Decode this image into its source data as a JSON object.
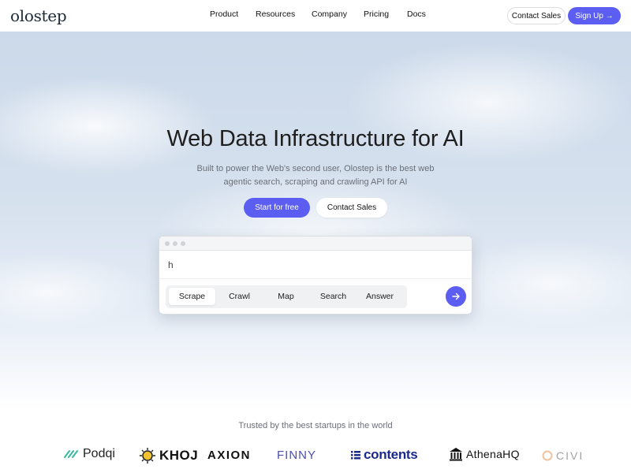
{
  "header": {
    "logo": "olostep",
    "nav": [
      "Product",
      "Resources",
      "Company",
      "Pricing",
      "Docs"
    ],
    "contact_label": "Contact Sales",
    "signup_label": "Sign Up →"
  },
  "hero": {
    "title": "Web Data Infrastructure for AI",
    "subtitle_line1": "Built to power the Web's second user, Olostep is the best web",
    "subtitle_line2": "agentic search, scraping and crawling API for AI",
    "start_label": "Start for free",
    "contact_label": "Contact Sales"
  },
  "demo": {
    "query_value": "h",
    "tabs": [
      "Scrape",
      "Crawl",
      "Map",
      "Search",
      "Answer"
    ],
    "active_tab": "Scrape"
  },
  "trusted": {
    "heading": "Trusted by the best startups in the world",
    "logos": [
      "Podqi",
      "KHOJ",
      "AXION",
      "FINNY",
      "contents",
      "AthenaHQ",
      "CIVI"
    ]
  },
  "colors": {
    "accent": "#5b5ef0",
    "text": "#1f1f1f",
    "muted": "#6b6f77"
  }
}
